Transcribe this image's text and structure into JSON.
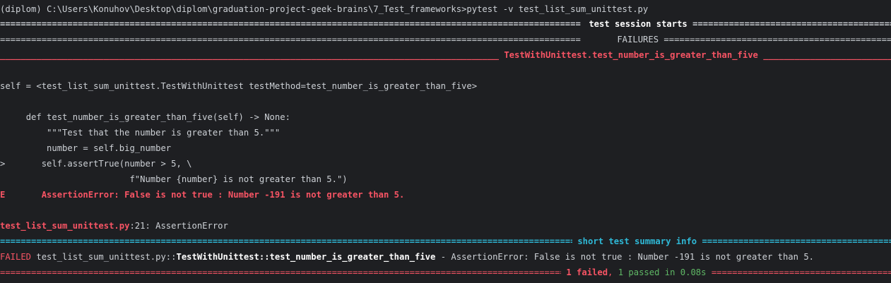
{
  "prompt": {
    "env": "(diplom)",
    "path": "C:\\Users\\Konuhov\\Desktop\\diplom\\graduation-project-geek-brains\\7_Test_frameworks>",
    "command": "pytest -v test_list_sum_unittest.py"
  },
  "banners": {
    "session": "test session starts",
    "failures": "FAILURES",
    "failure_title": "TestWithUnittest.test_number_is_greater_than_five",
    "summary": "short test summary info"
  },
  "traceback": {
    "self_line": "self = <test_list_sum_unittest.TestWithUnittest testMethod=test_number_is_greater_than_five>",
    "code": [
      {
        "marker": " ",
        "text": "    def test_number_is_greater_than_five(self) -> None:"
      },
      {
        "marker": " ",
        "text": "        \"\"\"Test that the number is greater than 5.\"\"\""
      },
      {
        "marker": " ",
        "text": "        number = self.big_number"
      },
      {
        "marker": ">",
        "text": "       self.assertTrue(number > 5, \\"
      },
      {
        "marker": " ",
        "text": "                        f\"Number {number} is not greater than 5.\")"
      }
    ],
    "error_marker": "E",
    "error_text": "       AssertionError: False is not true : Number -191 is not greater than 5.",
    "location_file": "test_list_sum_unittest.py",
    "location_rest": ":21: AssertionError"
  },
  "summary": {
    "status": "FAILED",
    "file": " test_list_sum_unittest.py::",
    "nodeid": "TestWithUnittest::test_number_is_greater_than_five",
    "message": " - AssertionError: False is not true : Number -191 is not greater than 5."
  },
  "result": {
    "failed": "1 failed",
    "sep": ", ",
    "passed": "1 passed in 0.08s"
  },
  "colors": {
    "background": "#1e1f22",
    "text": "#cdd1d6",
    "error_red": "#f75464",
    "pass_green": "#5fb865",
    "summary_cyan": "#2fb8d6"
  }
}
